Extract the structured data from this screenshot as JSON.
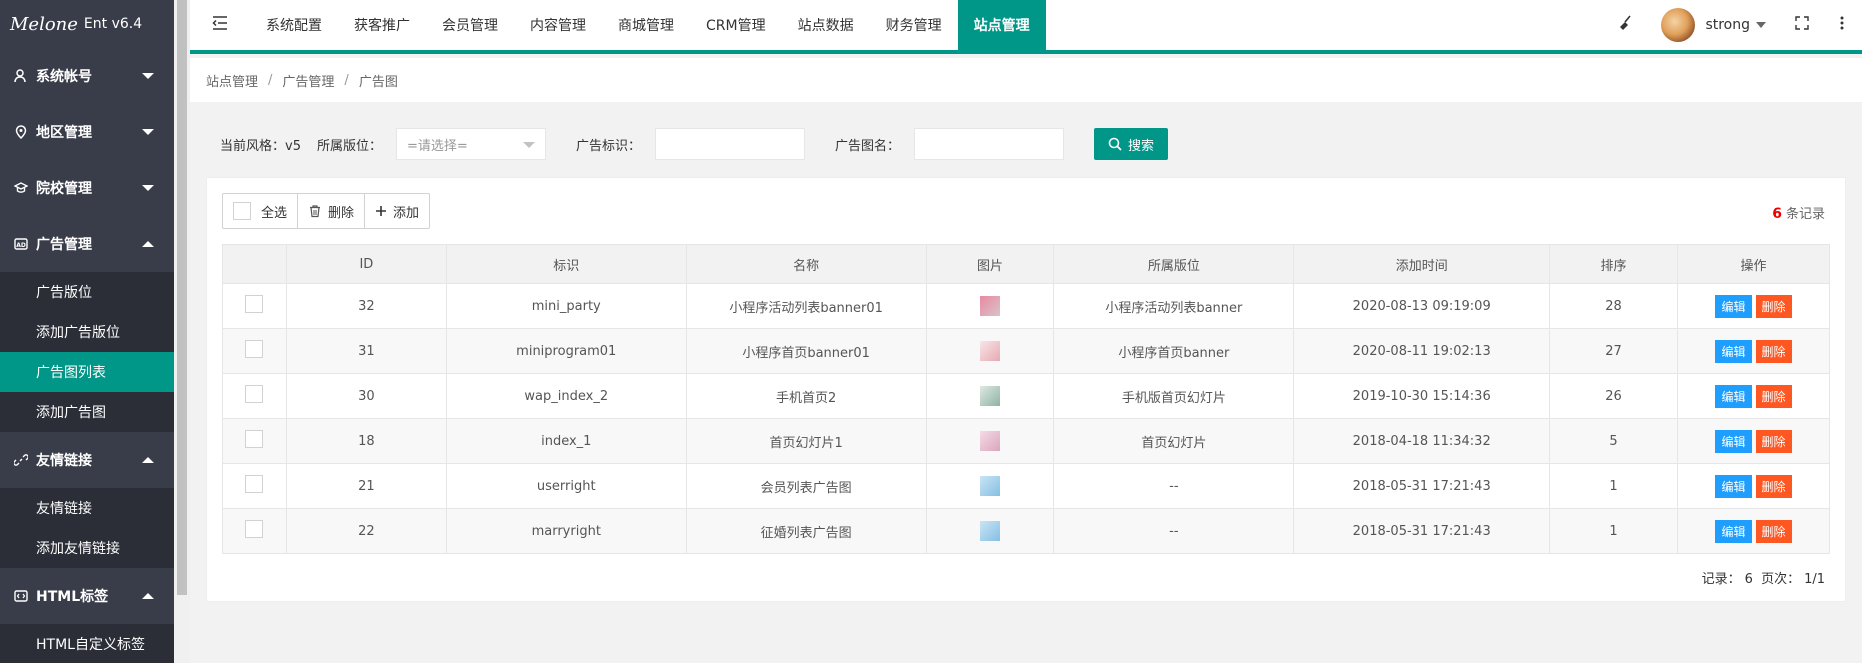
{
  "app": {
    "brand": "Melone",
    "version": "Ent v6.4"
  },
  "sidebar": {
    "groups": [
      {
        "label": "系统帐号",
        "icon": "user-icon",
        "expanded": false,
        "items": []
      },
      {
        "label": "地区管理",
        "icon": "location-icon",
        "expanded": false,
        "items": []
      },
      {
        "label": "院校管理",
        "icon": "graduation-cap-icon",
        "expanded": false,
        "items": []
      },
      {
        "label": "广告管理",
        "icon": "ad-icon",
        "expanded": true,
        "items": [
          "广告版位",
          "添加广告版位",
          "广告图列表",
          "添加广告图"
        ]
      },
      {
        "label": "友情链接",
        "icon": "link-icon",
        "expanded": true,
        "items": [
          "友情链接",
          "添加友情链接"
        ]
      },
      {
        "label": "HTML标签",
        "icon": "code-icon",
        "expanded": true,
        "items": [
          "HTML自定义标签"
        ]
      }
    ],
    "active_item": "广告图列表"
  },
  "topnav": {
    "items": [
      "系统配置",
      "获客推广",
      "会员管理",
      "内容管理",
      "商城管理",
      "CRM管理",
      "站点数据",
      "财务管理",
      "站点管理"
    ],
    "active": "站点管理",
    "username": "strong"
  },
  "breadcrumb": [
    "站点管理",
    "广告管理",
    "广告图"
  ],
  "filter": {
    "style_label": "当前风格：",
    "style_value": "v5",
    "position_label": "所属版位：",
    "position_placeholder": "=请选择=",
    "tag_label": "广告标识：",
    "name_label": "广告图名：",
    "search_label": "搜索"
  },
  "toolbar": {
    "select_all": "全选",
    "delete": "删除",
    "add": "添加"
  },
  "records": {
    "count": "6",
    "suffix": "条记录"
  },
  "table": {
    "headers": [
      "",
      "ID",
      "标识",
      "名称",
      "图片",
      "所属版位",
      "添加时间",
      "排序",
      "操作"
    ],
    "rows": [
      {
        "id": "32",
        "tag": "mini_party",
        "name": "小程序活动列表banner01",
        "thumb": "#e88aa0",
        "position": "小程序活动列表banner",
        "time": "2020-08-13 09:19:09",
        "order": "28"
      },
      {
        "id": "31",
        "tag": "miniprogram01",
        "name": "小程序首页banner01",
        "thumb": "#f3d4d8",
        "position": "小程序首页banner",
        "time": "2020-08-11 19:02:13",
        "order": "27"
      },
      {
        "id": "30",
        "tag": "wap_index_2",
        "name": "手机首页2",
        "thumb": "#b7d0c6",
        "position": "手机版首页幻灯片",
        "time": "2019-10-30 15:14:36",
        "order": "26"
      },
      {
        "id": "18",
        "tag": "index_1",
        "name": "首页幻灯片1",
        "thumb": "#ecc3d2",
        "position": "首页幻灯片",
        "time": "2018-04-18 11:34:32",
        "order": "5"
      },
      {
        "id": "21",
        "tag": "userright",
        "name": "会员列表广告图",
        "thumb": "#a9d3ef",
        "position": "--",
        "time": "2018-05-31 17:21:43",
        "order": "1"
      },
      {
        "id": "22",
        "tag": "marryright",
        "name": "征婚列表广告图",
        "thumb": "#a9d3ef",
        "position": "--",
        "time": "2018-05-31 17:21:43",
        "order": "1"
      }
    ],
    "edit_label": "编辑",
    "delete_label": "删除"
  },
  "pager": {
    "records_label": "记录：",
    "records_value": "6",
    "pages_label": "页次：",
    "pages_value": "1/1"
  }
}
